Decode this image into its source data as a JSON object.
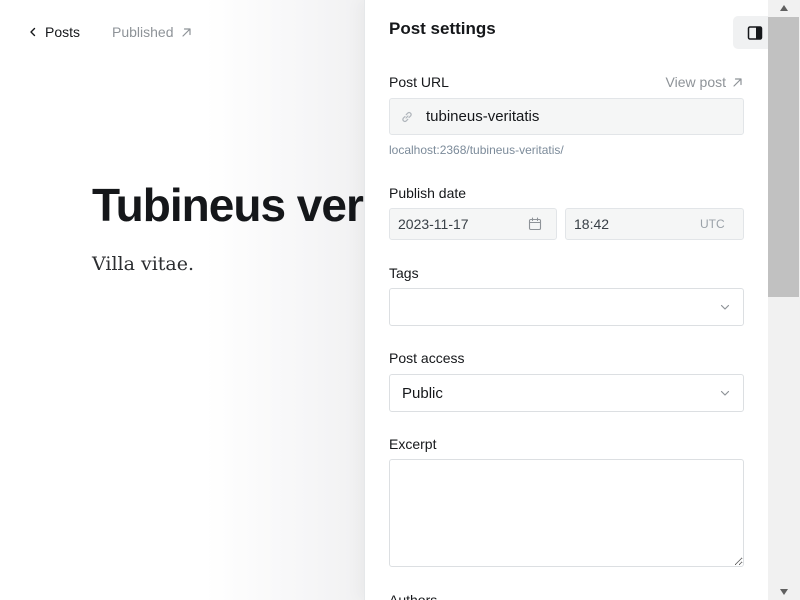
{
  "editor": {
    "nav": {
      "back_label": "Posts",
      "status_label": "Published"
    },
    "post_title": "Tubineus veritatis",
    "post_body": "Villa vitae."
  },
  "panel": {
    "title": "Post settings",
    "post_url": {
      "label": "Post URL",
      "view_post_label": "View post",
      "value": "tubineus-veritatis",
      "hint": "localhost:2368/tubineus-veritatis/"
    },
    "publish_date": {
      "label": "Publish date",
      "date_value": "2023-11-17",
      "time_value": "18:42",
      "timezone": "UTC"
    },
    "tags": {
      "label": "Tags",
      "value": ""
    },
    "post_access": {
      "label": "Post access",
      "value": "Public"
    },
    "excerpt": {
      "label": "Excerpt",
      "value": ""
    },
    "authors": {
      "label": "Authors"
    }
  },
  "icons": {
    "back": "chevron-left-icon",
    "external": "arrow-up-right-icon",
    "sidebar_toggle": "sidebar-toggle-icon",
    "link": "link-icon",
    "calendar": "calendar-icon",
    "dropdown": "chevron-down-icon"
  },
  "colors": {
    "text": "#15171a",
    "muted": "#8e9398",
    "hint": "#7c8b9a",
    "field_bg": "#f5f6f6",
    "border": "#dcdfe2"
  }
}
